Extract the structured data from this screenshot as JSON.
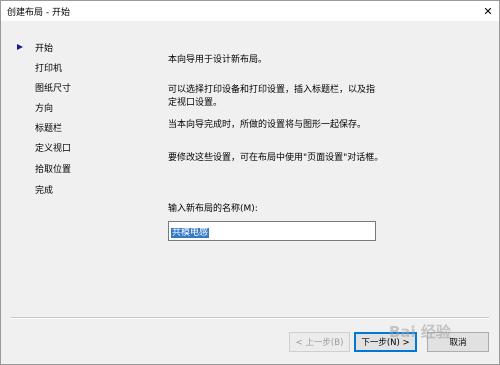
{
  "window": {
    "title": "创建布局 - 开始",
    "close_symbol": "✕"
  },
  "steps": [
    "开始",
    "打印机",
    "图纸尺寸",
    "方向",
    "标题栏",
    "定义视口",
    "拾取位置",
    "完成"
  ],
  "paragraphs": [
    "本向导用于设计新布局。",
    "可以选择打印设备和打印设置，插入标题栏，以及指",
    "定视口设置。",
    "当本向导完成时，所做的设置将与图形一起保存。",
    "要修改这些设置，可在布局中使用\"页面设置\"对话框。"
  ],
  "name_field": {
    "label": "输入新布局的名称(M):",
    "value": "共模电感"
  },
  "buttons": {
    "back": "< 上一步(B)",
    "next": "下一步(N) >",
    "cancel": "取消"
  },
  "watermark": "Bai 经验"
}
